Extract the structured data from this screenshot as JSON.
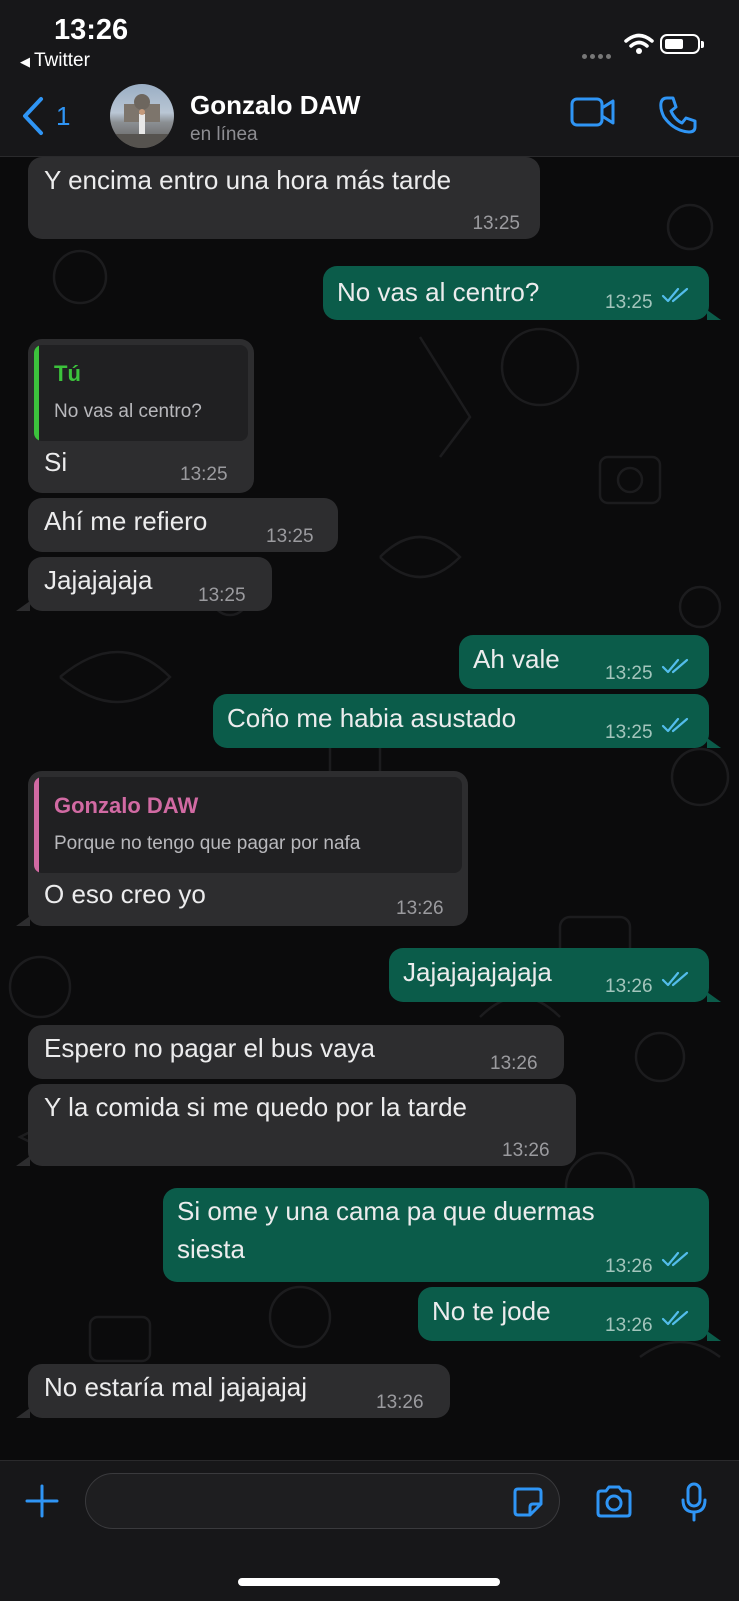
{
  "status_bar": {
    "time": "13:26",
    "back_app": "Twitter"
  },
  "header": {
    "back_count": "1",
    "contact_name": "Gonzalo DAW",
    "contact_status": "en línea"
  },
  "messages": [
    {
      "dir": "in",
      "text": "Y encima entro una hora más tarde",
      "time": "13:25"
    },
    {
      "dir": "out",
      "text": "No vas al centro?",
      "time": "13:25"
    },
    {
      "dir": "in",
      "quote_name": "Tú",
      "quote_text": "No vas al centro?",
      "quote_color": "#3cc23c",
      "text": "Si",
      "time": "13:25"
    },
    {
      "dir": "in",
      "text": "Ahí me refiero",
      "time": "13:25"
    },
    {
      "dir": "in",
      "text": "Jajajajaja",
      "time": "13:25"
    },
    {
      "dir": "out",
      "text": "Ah vale",
      "time": "13:25"
    },
    {
      "dir": "out",
      "text": "Coño me habia asustado",
      "time": "13:25"
    },
    {
      "dir": "in",
      "quote_name": "Gonzalo DAW",
      "quote_text": "Porque no tengo que pagar por nafa",
      "quote_color": "#d16aa3",
      "text": "O eso creo yo",
      "time": "13:26"
    },
    {
      "dir": "out",
      "text": "Jajajajajajaja",
      "time": "13:26"
    },
    {
      "dir": "in",
      "text": "Espero no pagar el bus vaya",
      "time": "13:26"
    },
    {
      "dir": "in",
      "text": "Y la comida si me quedo por la tarde",
      "time": "13:26"
    },
    {
      "dir": "out",
      "text": "Si ome y una cama pa que duermas",
      "text2": "siesta",
      "time": "13:26"
    },
    {
      "dir": "out",
      "text": "No te jode",
      "time": "13:26"
    },
    {
      "dir": "in",
      "text": "No estaría mal jajajajaj",
      "time": "13:26"
    }
  ],
  "colors": {
    "accent": "#2f95f5",
    "outgoing_bubble": "#0b5c4a",
    "incoming_bubble": "#2d2d2f",
    "read_ticks": "#53bdeb"
  },
  "icons": [
    "back-chevron-icon",
    "video-call-icon",
    "phone-icon",
    "plus-icon",
    "sticker-icon",
    "camera-icon",
    "microphone-icon",
    "wifi-icon",
    "battery-icon"
  ]
}
